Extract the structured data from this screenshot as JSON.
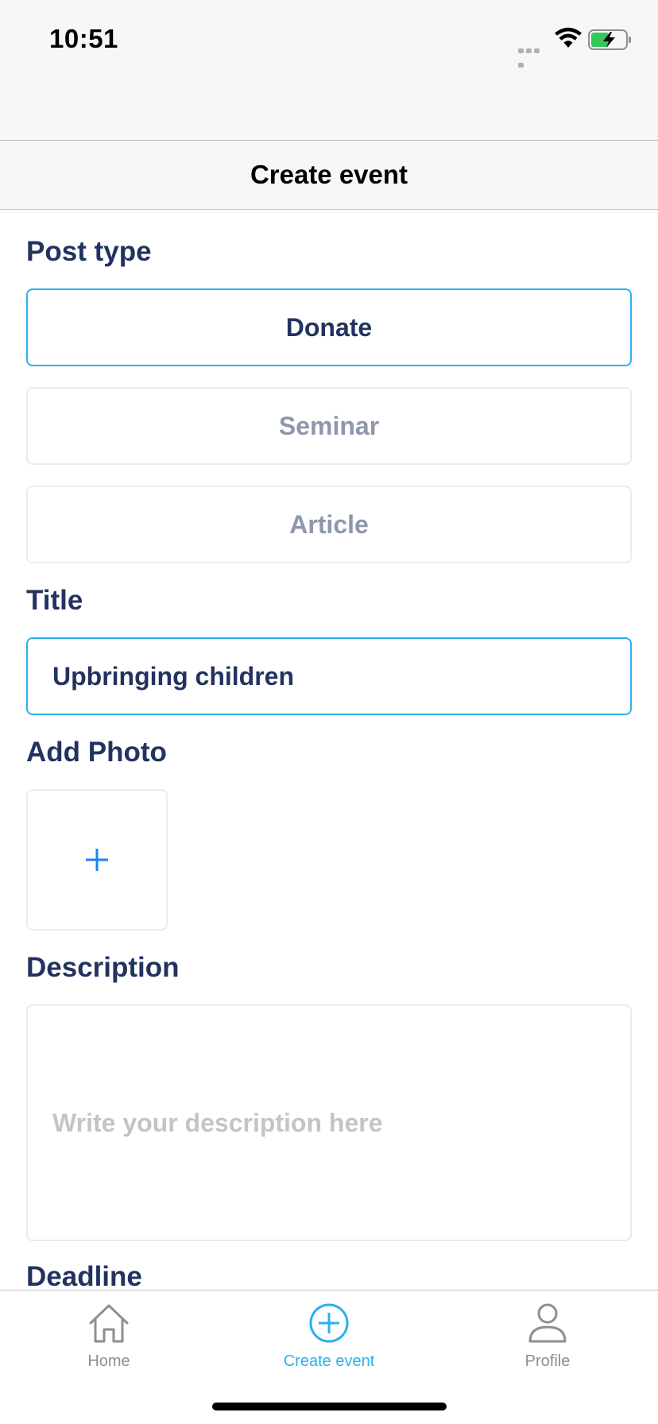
{
  "status_bar": {
    "time": "10:51"
  },
  "nav": {
    "title": "Create event"
  },
  "form": {
    "post_type_label": "Post type",
    "options": [
      {
        "label": "Donate",
        "selected": true
      },
      {
        "label": "Seminar",
        "selected": false
      },
      {
        "label": "Article",
        "selected": false
      }
    ],
    "title_label": "Title",
    "title_value": "Upbringing children",
    "photo_label": "Add Photo",
    "description_label": "Description",
    "description_placeholder": "Write your description here",
    "deadline_label": "Deadline"
  },
  "tab_bar": {
    "items": [
      {
        "label": "Home",
        "icon": "home-icon",
        "active": false
      },
      {
        "label": "Create event",
        "icon": "plus-circle-icon",
        "active": true
      },
      {
        "label": "Profile",
        "icon": "person-icon",
        "active": false
      }
    ]
  },
  "colors": {
    "accent": "#2bb0ee",
    "label_navy": "#223360",
    "muted": "#8e97ac",
    "placeholder": "#c4c4c8"
  }
}
